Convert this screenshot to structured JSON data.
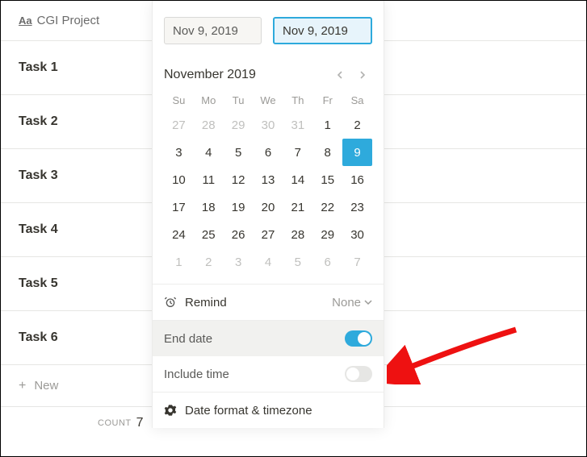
{
  "header": {
    "column_label": "CGI Project"
  },
  "tasks": [
    "Task 1",
    "Task 2",
    "Task 3",
    "Task 4",
    "Task 5",
    "Task 6"
  ],
  "new_label": "New",
  "count_label": "COUNT",
  "count_value": "7",
  "picker": {
    "start": "Nov 9, 2019",
    "end": "Nov 9, 2019",
    "month_title": "November 2019",
    "dow": [
      "Su",
      "Mo",
      "Tu",
      "We",
      "Th",
      "Fr",
      "Sa"
    ],
    "weeks": [
      [
        {
          "n": "27",
          "m": true
        },
        {
          "n": "28",
          "m": true
        },
        {
          "n": "29",
          "m": true
        },
        {
          "n": "30",
          "m": true
        },
        {
          "n": "31",
          "m": true
        },
        {
          "n": "1"
        },
        {
          "n": "2"
        }
      ],
      [
        {
          "n": "3"
        },
        {
          "n": "4"
        },
        {
          "n": "5"
        },
        {
          "n": "6"
        },
        {
          "n": "7"
        },
        {
          "n": "8"
        },
        {
          "n": "9",
          "sel": true
        }
      ],
      [
        {
          "n": "10"
        },
        {
          "n": "11"
        },
        {
          "n": "12"
        },
        {
          "n": "13"
        },
        {
          "n": "14"
        },
        {
          "n": "15"
        },
        {
          "n": "16"
        }
      ],
      [
        {
          "n": "17"
        },
        {
          "n": "18"
        },
        {
          "n": "19"
        },
        {
          "n": "20"
        },
        {
          "n": "21"
        },
        {
          "n": "22"
        },
        {
          "n": "23"
        }
      ],
      [
        {
          "n": "24"
        },
        {
          "n": "25"
        },
        {
          "n": "26"
        },
        {
          "n": "27"
        },
        {
          "n": "28"
        },
        {
          "n": "29"
        },
        {
          "n": "30"
        }
      ],
      [
        {
          "n": "1",
          "m": true
        },
        {
          "n": "2",
          "m": true
        },
        {
          "n": "3",
          "m": true
        },
        {
          "n": "4",
          "m": true
        },
        {
          "n": "5",
          "m": true
        },
        {
          "n": "6",
          "m": true
        },
        {
          "n": "7",
          "m": true
        }
      ]
    ],
    "remind_label": "Remind",
    "remind_value": "None",
    "end_date_label": "End date",
    "include_time_label": "Include time",
    "format_label": "Date format & timezone"
  }
}
